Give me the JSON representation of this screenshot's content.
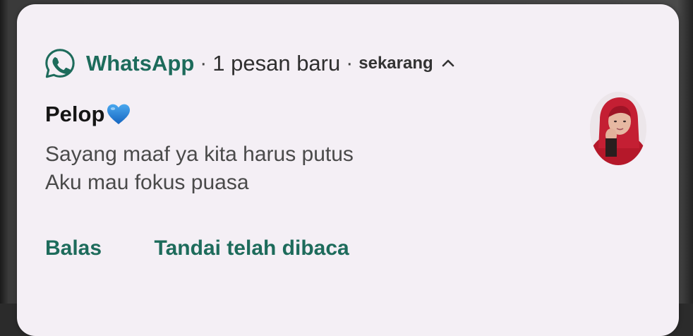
{
  "notification": {
    "app_name": "WhatsApp",
    "separator": "·",
    "message_count_text": "1 pesan baru",
    "time_text": "sekarang",
    "sender_name": "Pelop",
    "sender_emoji": "blue-heart",
    "message_lines": [
      "Sayang maaf ya kita harus putus",
      "Aku mau fokus puasa"
    ],
    "actions": {
      "reply_label": "Balas",
      "mark_read_label": "Tandai telah dibaca"
    }
  },
  "colors": {
    "accent": "#1d6b5b",
    "card_background": "#f4eff5",
    "heart": "#1e7fd6"
  },
  "icons": {
    "app": "whatsapp-icon",
    "expand": "chevron-up-icon",
    "emoji": "blue-heart-icon",
    "avatar": "contact-avatar"
  }
}
